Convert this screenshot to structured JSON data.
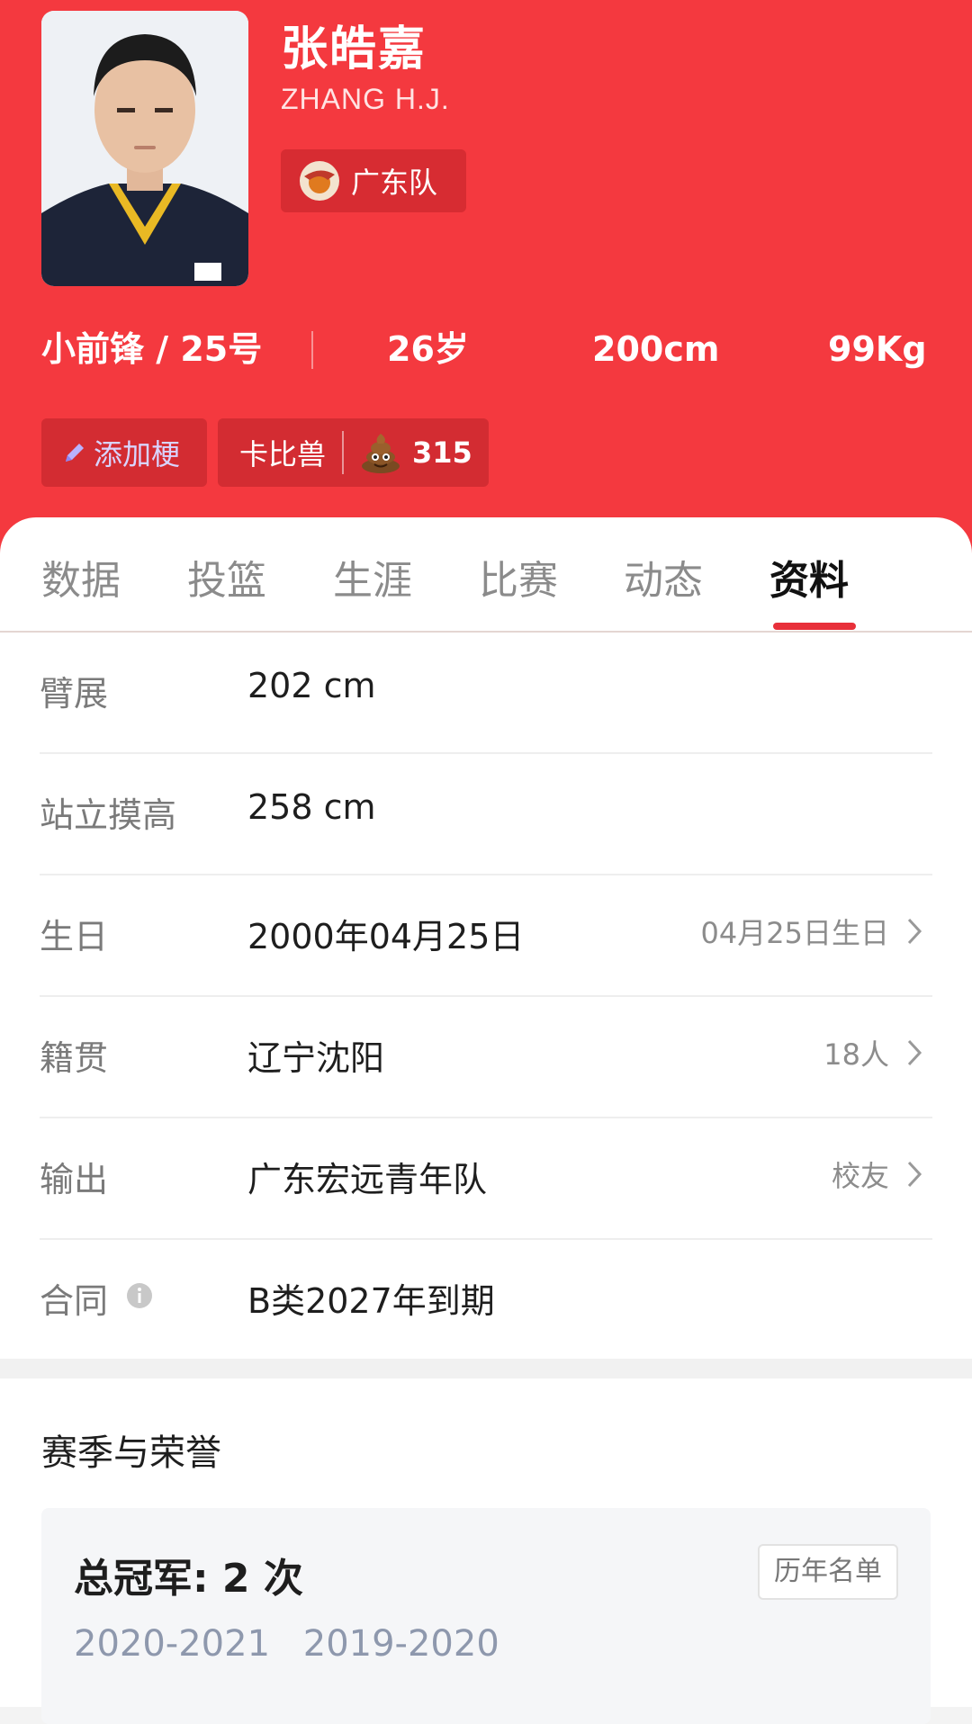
{
  "player": {
    "name": "张皓嘉",
    "name_en": "ZHANG H.J.",
    "team": "广东队",
    "position_number": "小前锋 / 25号",
    "age": "26岁",
    "height": "200cm",
    "weight": "99Kg"
  },
  "tags": {
    "add_label": "添加梗",
    "nickname": "卡比兽",
    "count": "315"
  },
  "tabs": [
    "数据",
    "投篮",
    "生涯",
    "比赛",
    "动态",
    "资料"
  ],
  "active_tab": "资料",
  "info": [
    {
      "label": "臂展",
      "value": "202 cm",
      "extra": ""
    },
    {
      "label": "站立摸高",
      "value": "258 cm",
      "extra": ""
    },
    {
      "label": "生日",
      "value": "2000年04月25日",
      "extra": "04月25日生日"
    },
    {
      "label": "籍贯",
      "value": "辽宁沈阳",
      "extra": "18人"
    },
    {
      "label": "输出",
      "value": "广东宏远青年队",
      "extra": "校友"
    },
    {
      "label": "合同",
      "value": "B类2027年到期",
      "extra": ""
    }
  ],
  "honors": {
    "section_title": "赛季与荣誉",
    "title": "总冠军: 2 次",
    "list_button": "历年名单",
    "seasons": [
      "2020-2021",
      "2019-2020"
    ]
  },
  "colors": {
    "brand_red": "#f4393f",
    "tab_underline": "#e8303a"
  }
}
